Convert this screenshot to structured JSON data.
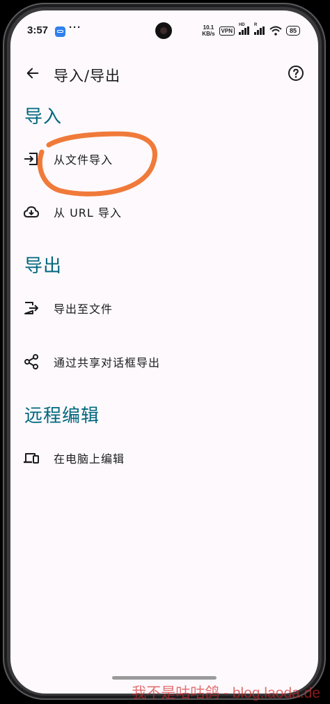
{
  "status_bar": {
    "time": "3:57",
    "dots": "···",
    "net_speed_value": "10.1",
    "net_speed_unit": "KB/s",
    "vpn": "VPN",
    "signal1_tag": "HD",
    "signal2_tag": "R",
    "battery": "85"
  },
  "app_bar": {
    "title": "导入/导出",
    "back_icon": "arrow-back-icon",
    "help_icon": "help-circle-icon"
  },
  "sections": [
    {
      "title": "导入",
      "items": [
        {
          "label": "从文件导入",
          "icon": "file-import-icon"
        },
        {
          "label": "从 URL 导入",
          "icon": "cloud-download-icon"
        }
      ]
    },
    {
      "title": "导出",
      "items": [
        {
          "label": "导出至文件",
          "icon": "file-export-icon"
        },
        {
          "label": "通过共享对话框导出",
          "icon": "share-icon"
        }
      ]
    },
    {
      "title": "远程编辑",
      "items": [
        {
          "label": "在电脑上编辑",
          "icon": "devices-icon"
        }
      ]
    }
  ],
  "colors": {
    "accent": "#01677e",
    "background": "#fdf9fc",
    "annotation": "#f07a3a"
  },
  "watermark": "我不是咕咕鸽 - blog.laoda.de"
}
